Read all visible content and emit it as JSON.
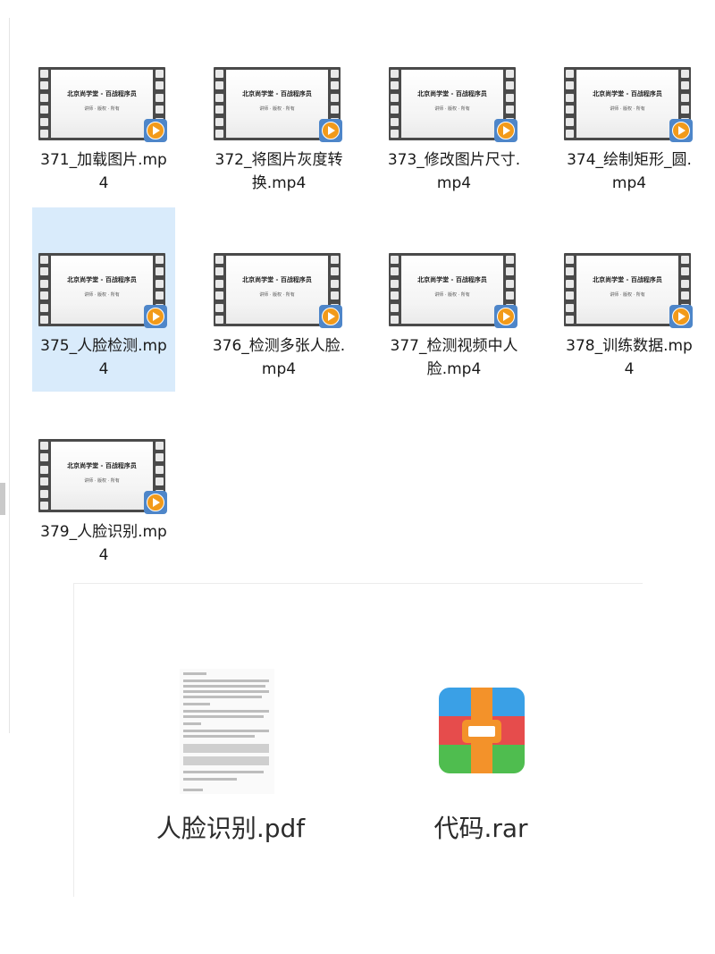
{
  "thumbnail_text": {
    "title": "北京尚学堂 - 百战程序员",
    "subtitle": "讲师 · 版权 · 所有"
  },
  "video_files": [
    {
      "name": "371_加载图片.mp4",
      "selected": false
    },
    {
      "name": "372_将图片灰度转换.mp4",
      "selected": false
    },
    {
      "name": "373_修改图片尺寸.mp4",
      "selected": false
    },
    {
      "name": "374_绘制矩形_圆.mp4",
      "selected": false
    },
    {
      "name": "375_人脸检测.mp4",
      "selected": true
    },
    {
      "name": "376_检测多张人脸.mp4",
      "selected": false
    },
    {
      "name": "377_检测视频中人脸.mp4",
      "selected": false
    },
    {
      "name": "378_训练数据.mp4",
      "selected": false
    },
    {
      "name": "379_人脸识别.mp4",
      "selected": false
    }
  ],
  "other_files": {
    "pdf": {
      "name": "人脸识别.pdf",
      "icon": "pdf-document-icon"
    },
    "rar": {
      "name": "代码.rar",
      "icon": "rar-archive-icon"
    }
  },
  "colors": {
    "selection": "#d9ebfb",
    "play_badge": "#4e86c9",
    "play_circle": "#f29a1a",
    "rar_blue": "#3aa0e6",
    "rar_red": "#e64c4c",
    "rar_green": "#4fbd4f",
    "rar_orange": "#f3922a"
  }
}
